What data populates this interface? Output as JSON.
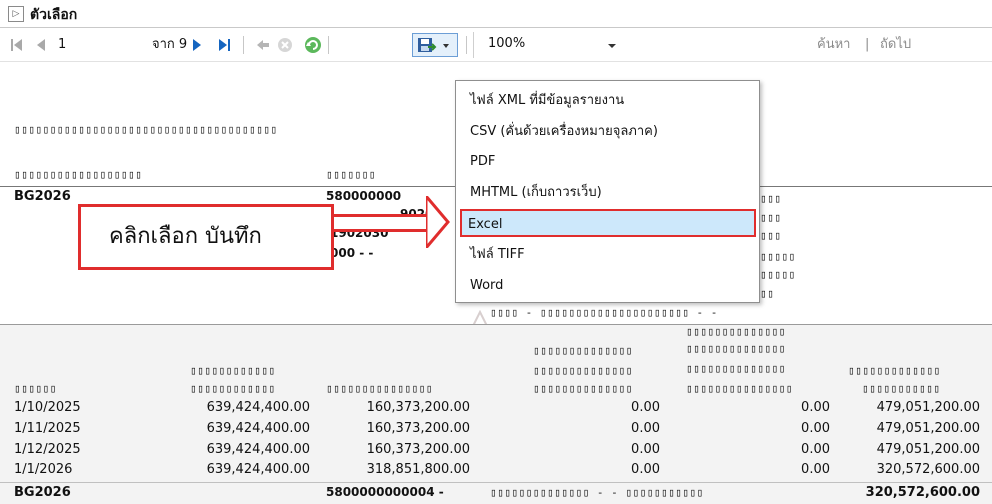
{
  "titlebar": {
    "expand_glyph": "▷",
    "title": "ตัวเลือก"
  },
  "toolbar": {
    "page_current": "1",
    "page_of": "จาก 9",
    "zoom_value": "100%",
    "find_label": "ค้นหา",
    "find_sep": "|",
    "next_label": "ถัดไป"
  },
  "export_menu": {
    "items": [
      {
        "label": "ไฟล์ XML ที่มีข้อมูลรายงาน"
      },
      {
        "label": "CSV (คั่นด้วยเครื่องหมายจุลภาค)"
      },
      {
        "label": "PDF"
      },
      {
        "label": "MHTML (เก็บถาวรเว็บ)"
      },
      {
        "label": "Excel"
      },
      {
        "label": "ไฟล์ TIFF"
      },
      {
        "label": "Word"
      }
    ],
    "selected_index": 4
  },
  "callout": {
    "text": "คลิกเลือก บันทึก"
  },
  "report": {
    "heading_line": "▯▯▯▯▯▯▯▯▯▯▯▯▯▯▯▯▯▯▯▯▯▯▯▯▯▯▯▯▯▯▯▯▯▯▯▯▯",
    "sub_line_left": "▯▯▯▯▯▯▯▯▯▯▯▯▯▯▯▯▯▯",
    "sub_line_mid": "▯▯▯▯▯▯▯",
    "code_left": "BG2026",
    "code_mid_a": "580000000",
    "code_mid_b": "9020",
    "code_mid_c": "1902030",
    "code_mid_d": "000 -  -",
    "right_frag_1": "▯▯▯",
    "right_frag_2": "▯▯▯",
    "right_frag_3": "▯▯▯",
    "right_frag_4": "▯▯▯▯▯",
    "right_frag_5": "▯▯▯▯▯",
    "right_frag_6": "▯▯",
    "dash_line": "▯▯▯▯ - ▯▯▯▯▯▯▯▯▯▯▯▯▯▯▯▯▯▯▯▯▯ - -",
    "col_headers": {
      "c1": "▯▯▯▯▯▯",
      "c2_l1": "▯▯▯▯▯▯▯▯▯▯▯▯",
      "c2_l2": "▯▯▯▯▯▯▯▯▯▯▯▯",
      "c3": "▯▯▯▯▯▯▯▯▯▯▯▯▯▯▯",
      "c4_l1": "▯▯▯▯▯▯▯▯▯▯▯▯▯▯",
      "c4_l2": "▯▯▯▯▯▯▯▯▯▯▯▯▯▯",
      "c4_l3": "▯▯▯▯▯▯▯▯▯▯▯▯▯▯",
      "c5_l1": "▯▯▯▯▯▯▯▯▯▯▯▯▯▯",
      "c5_l2": "▯▯▯▯▯▯▯▯▯▯▯▯▯▯",
      "c5_l3": "▯▯▯▯▯▯▯▯▯▯▯▯▯▯",
      "c5_l4": "▯▯▯▯▯▯▯▯▯▯▯▯▯▯▯",
      "c6_l1": "▯▯▯▯▯▯▯▯▯▯▯▯▯",
      "c6_l2": "▯▯▯▯▯▯▯▯▯▯▯"
    },
    "rows": [
      {
        "date": "1/10/2025",
        "a": "639,424,400.00",
        "b": "160,373,200.00",
        "c": "0.00",
        "d": "0.00",
        "e": "479,051,200.00"
      },
      {
        "date": "1/11/2025",
        "a": "639,424,400.00",
        "b": "160,373,200.00",
        "c": "0.00",
        "d": "0.00",
        "e": "479,051,200.00"
      },
      {
        "date": "1/12/2025",
        "a": "639,424,400.00",
        "b": "160,373,200.00",
        "c": "0.00",
        "d": "0.00",
        "e": "479,051,200.00"
      },
      {
        "date": "1/1/2026",
        "a": "639,424,400.00",
        "b": "318,851,800.00",
        "c": "0.00",
        "d": "0.00",
        "e": "320,572,600.00"
      }
    ],
    "footer": {
      "code": "BG2026",
      "mid": "5800000000004 -",
      "gloss": "▯▯▯▯▯▯▯▯▯▯▯▯▯▯ - - ▯▯▯▯▯▯▯▯▯▯▯",
      "total": "320,572,600.00"
    }
  },
  "colors": {
    "accent_red": "#e02d2d",
    "selected_bg": "#cde8fb",
    "nav_blue": "#1565c0"
  }
}
